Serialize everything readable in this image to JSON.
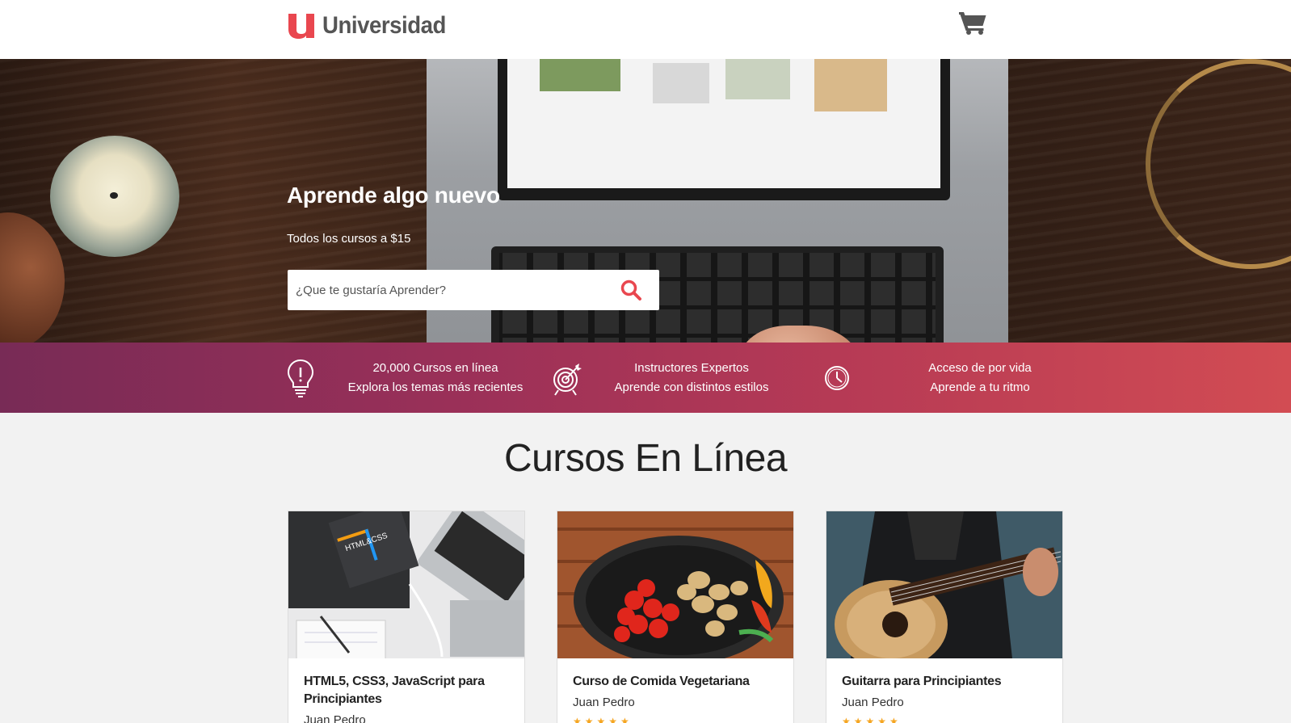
{
  "header": {
    "brand_name": "Universidad",
    "logo_letter": "u",
    "brand_color": "#e9474f",
    "cart_icon": "cart-icon"
  },
  "hero": {
    "title": "Aprende algo nuevo",
    "subtitle": "Todos los cursos a $15",
    "search_placeholder": "¿Que te gustaría Aprender?",
    "search_icon": "search-icon"
  },
  "benefits": [
    {
      "icon": "lightbulb-icon",
      "line1": "20,000 Cursos en línea",
      "line2": "Explora los temas más recientes"
    },
    {
      "icon": "target-icon",
      "line1": "Instructores Expertos",
      "line2": "Aprende con distintos estilos"
    },
    {
      "icon": "clock-icon",
      "line1": "Acceso de por vida",
      "line2": "Aprende a tu ritmo"
    }
  ],
  "courses": {
    "section_title": "Cursos En Línea",
    "items": [
      {
        "title": "HTML5, CSS3, JavaScript para Principiantes",
        "author": "Juan Pedro",
        "stars": "★★★★★"
      },
      {
        "title": "Curso de Comida Vegetariana",
        "author": "Juan Pedro",
        "stars": "★★★★★"
      },
      {
        "title": "Guitarra para Principiantes",
        "author": "Juan Pedro",
        "stars": "★★★★★"
      }
    ]
  },
  "colors": {
    "accent": "#e9474f",
    "bar_start": "#782b56",
    "bar_end": "#d24c53",
    "star": "#f5a623"
  }
}
